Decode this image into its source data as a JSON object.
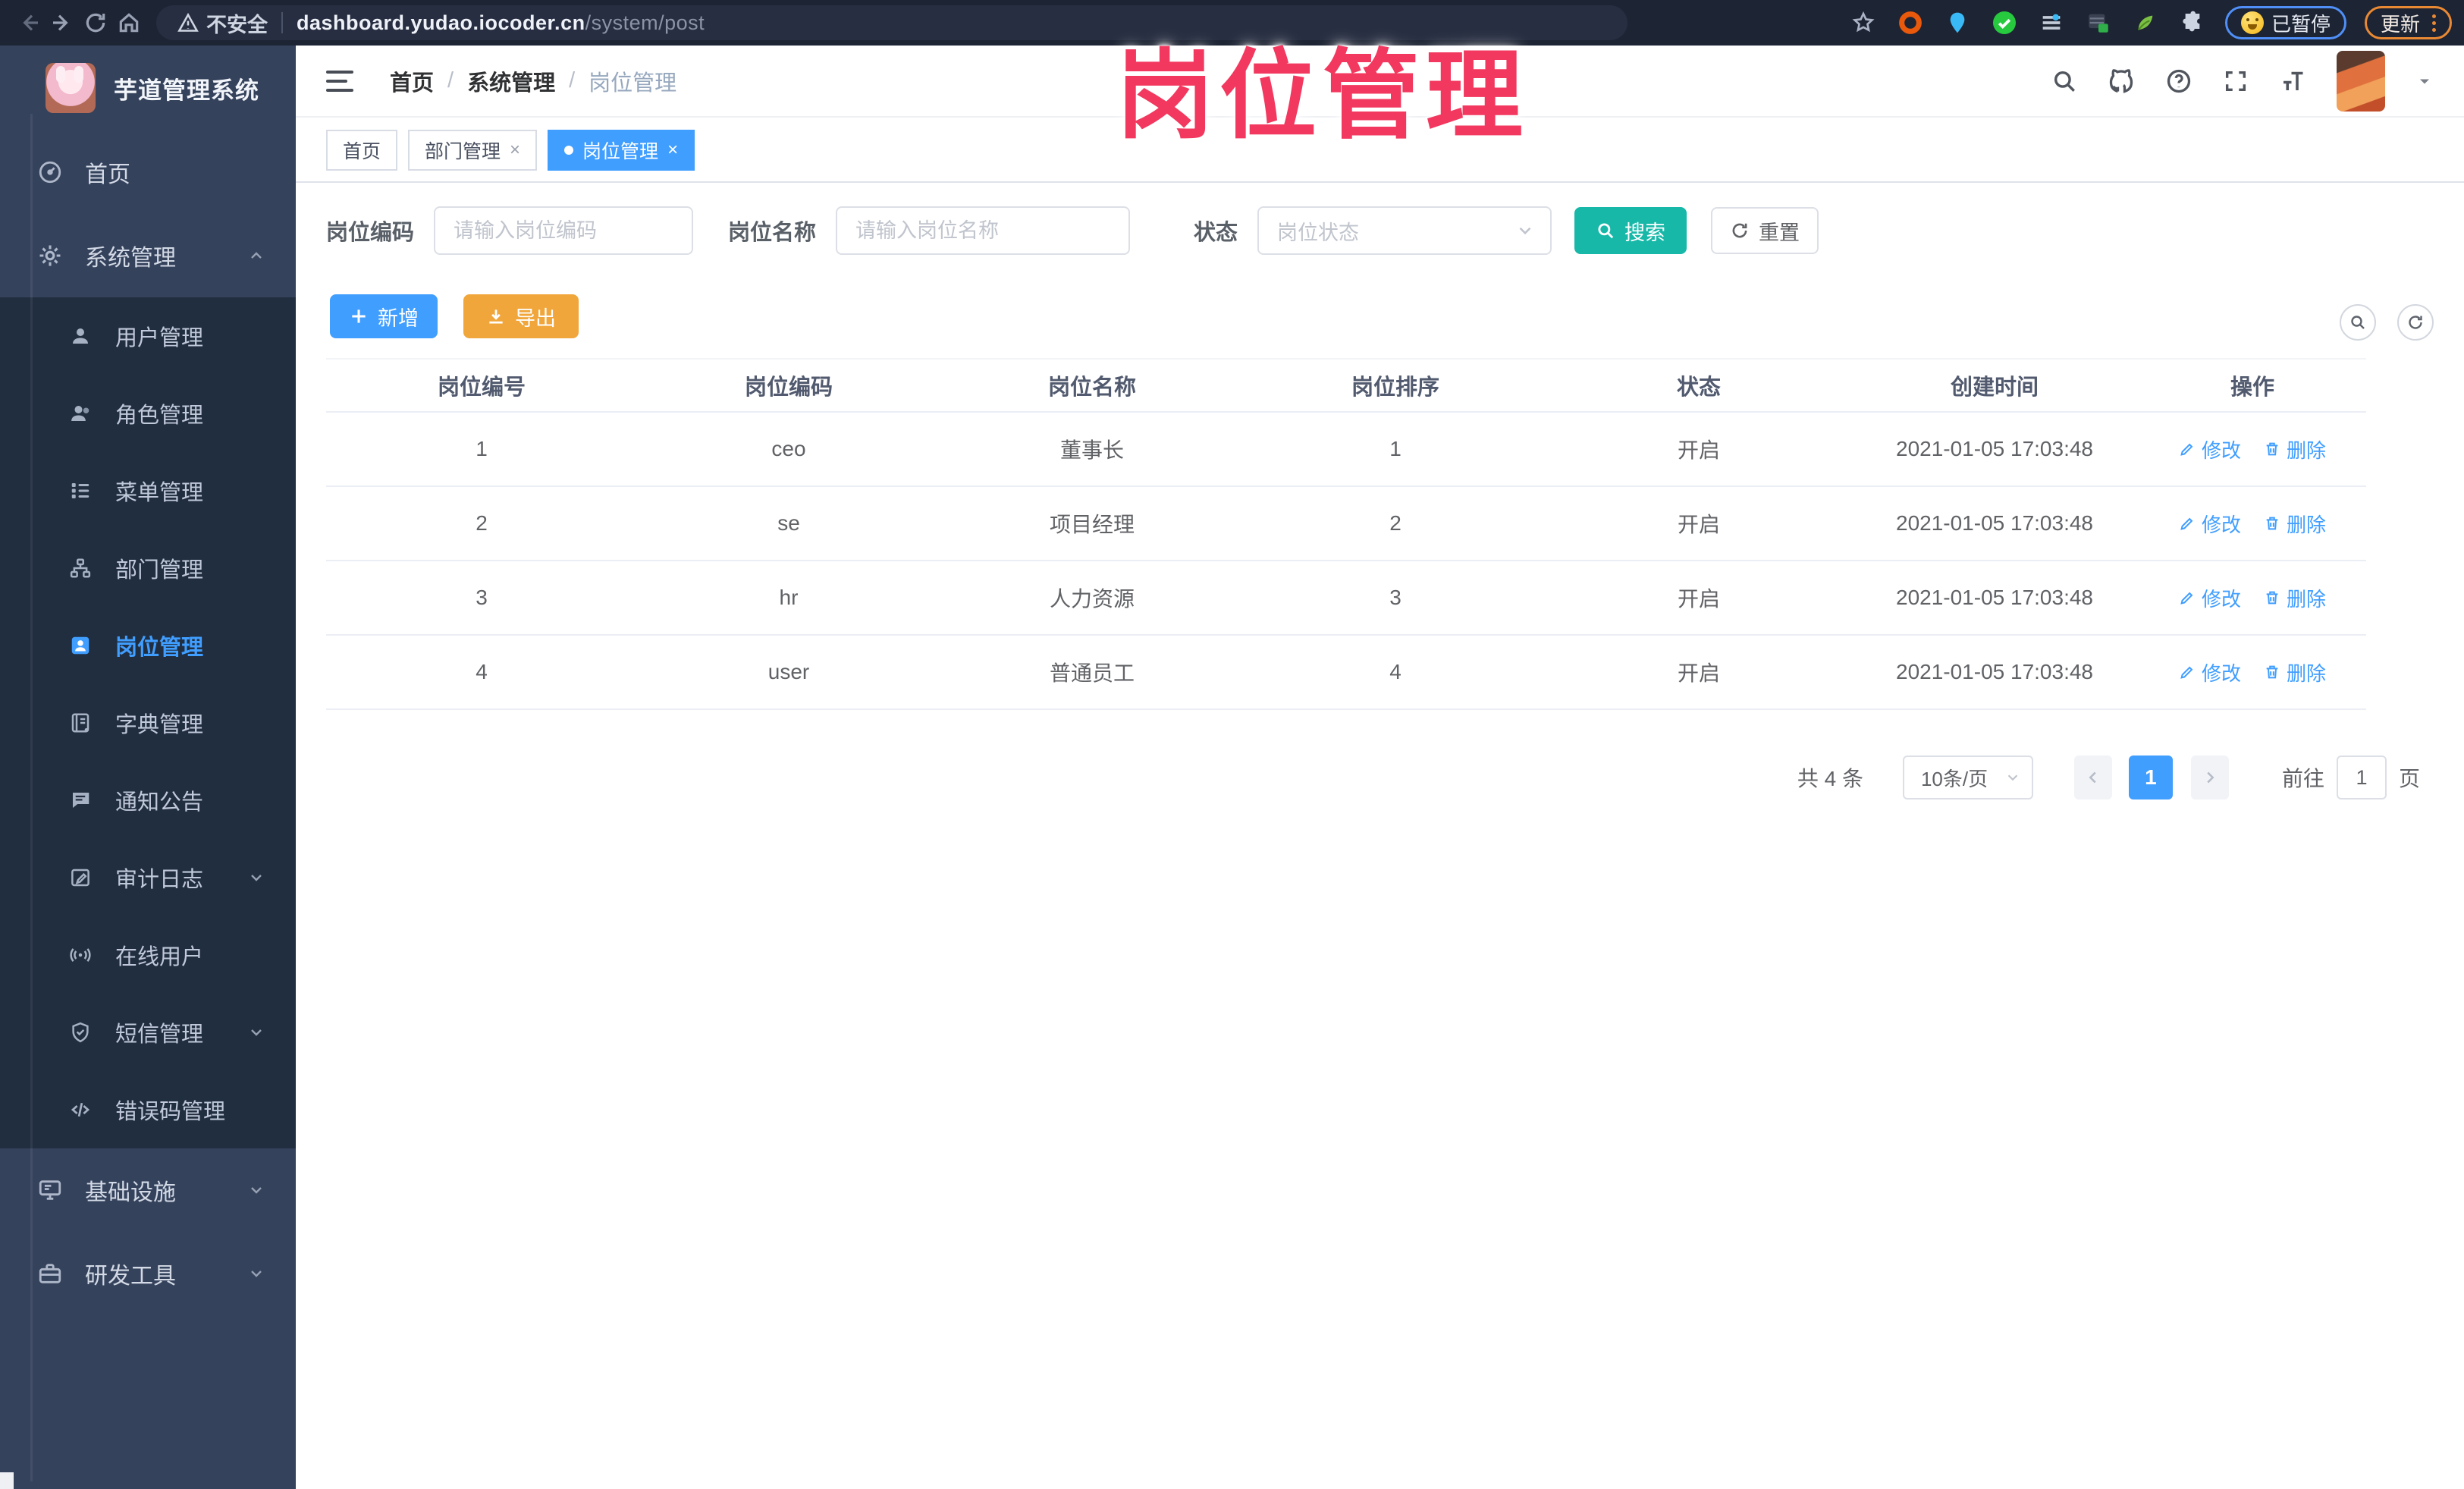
{
  "browser": {
    "security": "不安全",
    "host": "dashboard.yudao.iocoder.cn",
    "path": "/system/post",
    "paused_label": "已暂停",
    "update_label": "更新"
  },
  "app": {
    "title": "芋道管理系统"
  },
  "overlay": {
    "title": "岗位管理"
  },
  "breadcrumb": {
    "home": "首页",
    "section": "系统管理",
    "current": "岗位管理"
  },
  "tabs": {
    "home": "首页",
    "dept": "部门管理",
    "post": "岗位管理"
  },
  "sidebar": {
    "home": "首页",
    "system": "系统管理",
    "users": "用户管理",
    "roles": "角色管理",
    "menus": "菜单管理",
    "depts": "部门管理",
    "posts": "岗位管理",
    "dicts": "字典管理",
    "notices": "通知公告",
    "audit": "审计日志",
    "online": "在线用户",
    "sms": "短信管理",
    "errcodes": "错误码管理",
    "infra": "基础设施",
    "devtools": "研发工具"
  },
  "search": {
    "code_label": "岗位编码",
    "code_placeholder": "请输入岗位编码",
    "name_label": "岗位名称",
    "name_placeholder": "请输入岗位名称",
    "status_label": "状态",
    "status_placeholder": "岗位状态",
    "submit": "搜索",
    "reset": "重置"
  },
  "toolbar": {
    "add": "新增",
    "export": "导出"
  },
  "table": {
    "headers": {
      "id": "岗位编号",
      "code": "岗位编码",
      "name": "岗位名称",
      "sort": "岗位排序",
      "status": "状态",
      "created": "创建时间",
      "actions": "操作"
    },
    "edit": "修改",
    "remove": "删除",
    "rows": [
      {
        "id": "1",
        "code": "ceo",
        "name": "董事长",
        "sort": "1",
        "status": "开启",
        "created": "2021-01-05 17:03:48"
      },
      {
        "id": "2",
        "code": "se",
        "name": "项目经理",
        "sort": "2",
        "status": "开启",
        "created": "2021-01-05 17:03:48"
      },
      {
        "id": "3",
        "code": "hr",
        "name": "人力资源",
        "sort": "3",
        "status": "开启",
        "created": "2021-01-05 17:03:48"
      },
      {
        "id": "4",
        "code": "user",
        "name": "普通员工",
        "sort": "4",
        "status": "开启",
        "created": "2021-01-05 17:03:48"
      }
    ]
  },
  "pagination": {
    "total": "共 4 条",
    "size": "10条/页",
    "page": "1",
    "goto": "前往",
    "goto_value": "1",
    "unit": "页"
  },
  "colors": {
    "accent": "#409eff",
    "search_button": "#17b8a8",
    "export_button": "#f0a63a",
    "overlay_text": "#f2385e",
    "sidebar_bg": "#35425c",
    "submenu_bg": "#212e40",
    "browser_bar": "#1d2433"
  }
}
